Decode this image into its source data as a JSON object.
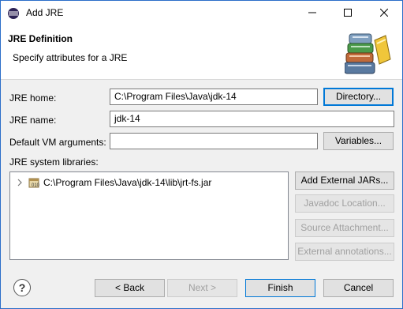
{
  "window": {
    "title": "Add JRE",
    "minimize_icon": "minimize-icon",
    "maximize_icon": "maximize-icon",
    "close_icon": "close-icon"
  },
  "banner": {
    "title": "JRE Definition",
    "description": "Specify attributes for a JRE",
    "image_icon": "books-icon"
  },
  "form": {
    "jre_home_label": "JRE home:",
    "jre_home_value": "C:\\Program Files\\Java\\jdk-14",
    "directory_button": "Directory...",
    "jre_name_label": "JRE name:",
    "jre_name_value": "jdk-14",
    "vm_args_label": "Default VM arguments:",
    "vm_args_value": "",
    "variables_button": "Variables...",
    "system_libraries_label": "JRE system libraries:"
  },
  "libraries": [
    {
      "path": "C:\\Program Files\\Java\\jdk-14\\lib\\jrt-fs.jar",
      "expanded": false,
      "icon": "jar-icon"
    }
  ],
  "library_buttons": {
    "add_external_jars": "Add External JARs...",
    "javadoc_location": "Javadoc Location...",
    "source_attachment": "Source Attachment...",
    "external_annotations": "External annotations..."
  },
  "footer": {
    "help_icon": "help-icon",
    "back": "< Back",
    "next": "Next >",
    "finish": "Finish",
    "cancel": "Cancel"
  }
}
